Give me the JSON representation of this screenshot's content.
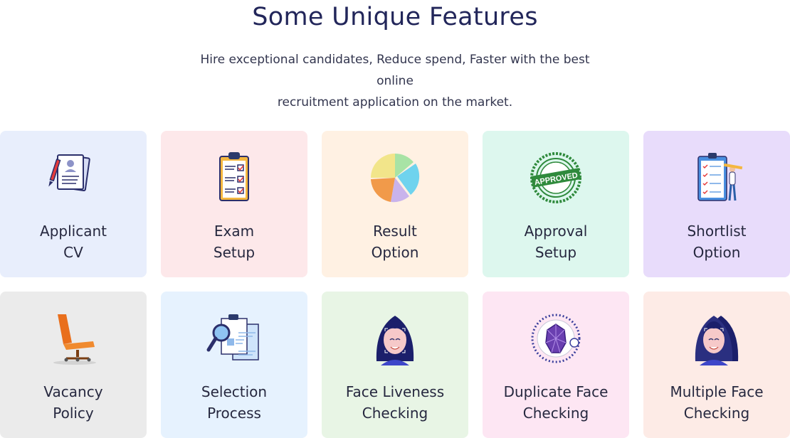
{
  "section": {
    "title": "Some Unique Features",
    "subtitle_line1": "Hire exceptional candidates, Reduce spend, Faster with the best online",
    "subtitle_line2": "recruitment application on the market."
  },
  "features": [
    {
      "line1": "Applicant",
      "line2": "CV",
      "icon": "cv-documents-icon",
      "bg": "#e8eefc"
    },
    {
      "line1": "Exam",
      "line2": "Setup",
      "icon": "clipboard-checklist-icon",
      "bg": "#fde8ea"
    },
    {
      "line1": "Result",
      "line2": "Option",
      "icon": "pie-chart-icon",
      "bg": "#fff1e3"
    },
    {
      "line1": "Approval",
      "line2": "Setup",
      "icon": "approved-stamp-icon",
      "bg": "#ddf7ee"
    },
    {
      "line1": "Shortlist",
      "line2": "Option",
      "icon": "shortlist-board-icon",
      "bg": "#e8dcfb"
    },
    {
      "line1": "Vacancy",
      "line2": "Policy",
      "icon": "office-chair-icon",
      "bg": "#ebebeb"
    },
    {
      "line1": "Selection",
      "line2": "Process",
      "icon": "search-documents-icon",
      "bg": "#e6f2fe"
    },
    {
      "line1": "Face Liveness",
      "line2": "Checking",
      "icon": "face-scan-icon",
      "bg": "#e8f5e5"
    },
    {
      "line1": "Duplicate Face",
      "line2": "Checking",
      "icon": "face-recognition-icon",
      "bg": "#fde6f3"
    },
    {
      "line1": "Multiple Face",
      "line2": "Checking",
      "icon": "multiple-faces-icon",
      "bg": "#fdebe6"
    }
  ]
}
